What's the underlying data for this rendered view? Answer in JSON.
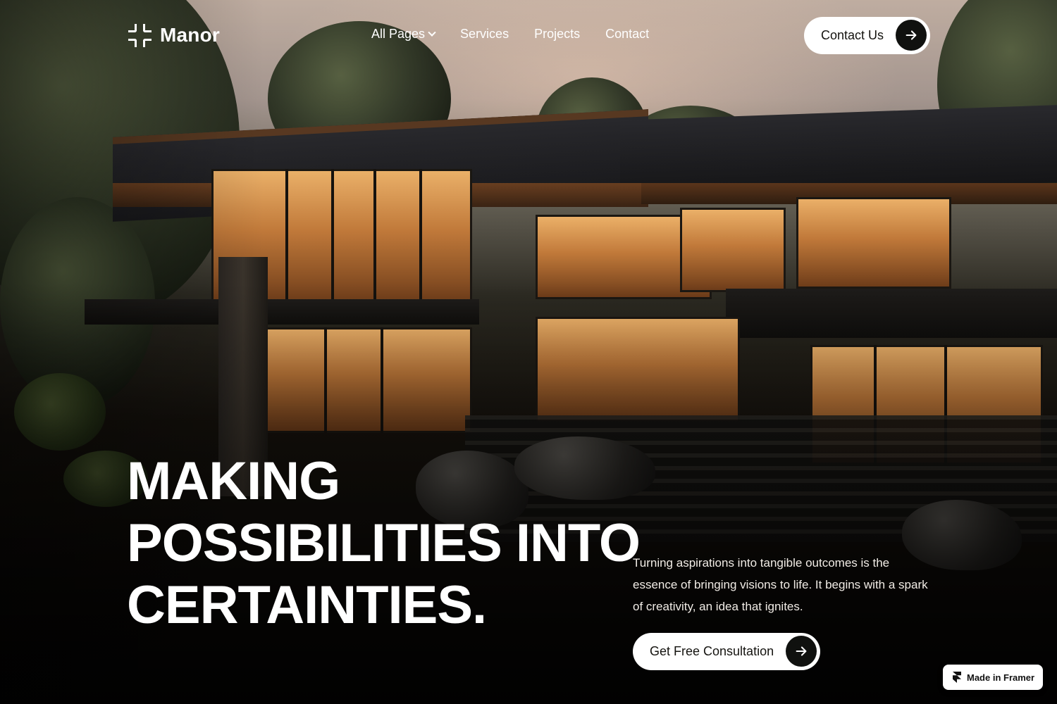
{
  "brand": {
    "name": "Manor",
    "logo_icon": "corner-brackets-icon"
  },
  "nav": {
    "items": [
      {
        "label": "All Pages",
        "has_dropdown": true
      },
      {
        "label": "Services"
      },
      {
        "label": "Projects"
      },
      {
        "label": "Contact"
      }
    ],
    "contact_button": {
      "label": "Contact Us",
      "icon": "arrow-right-icon"
    }
  },
  "hero": {
    "headline_lines": [
      "MAKING",
      "POSSIBILITIES INTO",
      "CERTAINTIES."
    ],
    "tagline": "Turning aspirations into tangible outcomes is the essence of bringing visions to life. It begins with a spark of creativity, an idea that ignites.",
    "cta": {
      "label": "Get Free Consultation",
      "icon": "arrow-right-icon"
    }
  },
  "badge": {
    "label": "Made in Framer",
    "icon": "framer-logo-icon"
  },
  "colors": {
    "button_bg": "#ffffff",
    "button_text": "#14130f",
    "arrow_circle": "#10110f",
    "text": "#ffffff"
  }
}
